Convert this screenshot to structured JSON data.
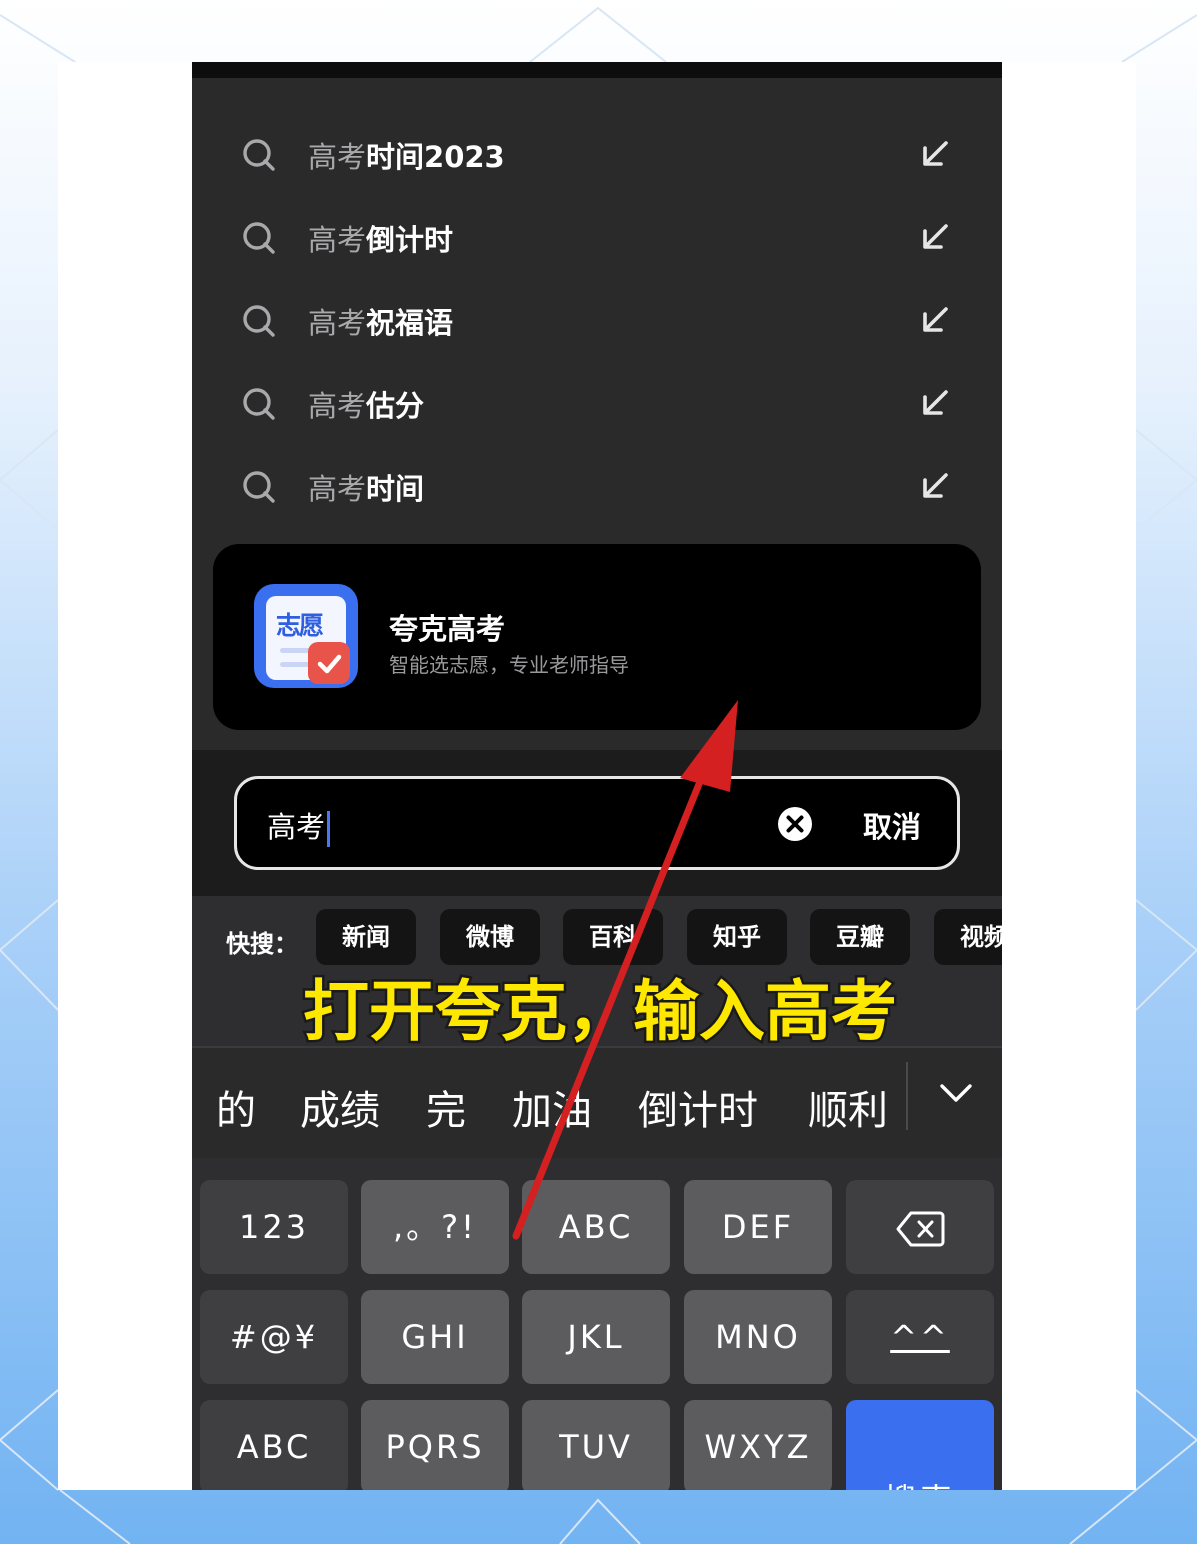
{
  "suggestions": [
    {
      "prefix": "高考",
      "rest": "时间2023"
    },
    {
      "prefix": "高考",
      "rest": "倒计时"
    },
    {
      "prefix": "高考",
      "rest": "祝福语"
    },
    {
      "prefix": "高考",
      "rest": "估分"
    },
    {
      "prefix": "高考",
      "rest": "时间"
    }
  ],
  "app_card": {
    "icon_text": "志愿",
    "title": "夸克高考",
    "subtitle": "智能选志愿，专业老师指导"
  },
  "search": {
    "query": "高考",
    "cancel_label": "取消"
  },
  "quick_search": {
    "label": "快搜：",
    "chips": [
      "新闻",
      "微博",
      "百科",
      "知乎",
      "豆瓣",
      "视频"
    ]
  },
  "caption": "打开夸克，输入高考",
  "candidates": [
    "的",
    "成绩",
    "完",
    "加油",
    "倒计时",
    "顺利"
  ],
  "keys": {
    "row1": [
      "123",
      ",。?!",
      "ABC",
      "DEF"
    ],
    "row2": [
      "#@¥",
      "GHI",
      "JKL",
      "MNO",
      "^^"
    ],
    "row3": [
      "ABC",
      "PQRS",
      "TUV",
      "WXYZ"
    ],
    "search_label": "搜索"
  },
  "colors": {
    "accent_blue": "#3a6ff0",
    "caption_yellow": "#ffe800",
    "arrow_red": "#d42020"
  }
}
